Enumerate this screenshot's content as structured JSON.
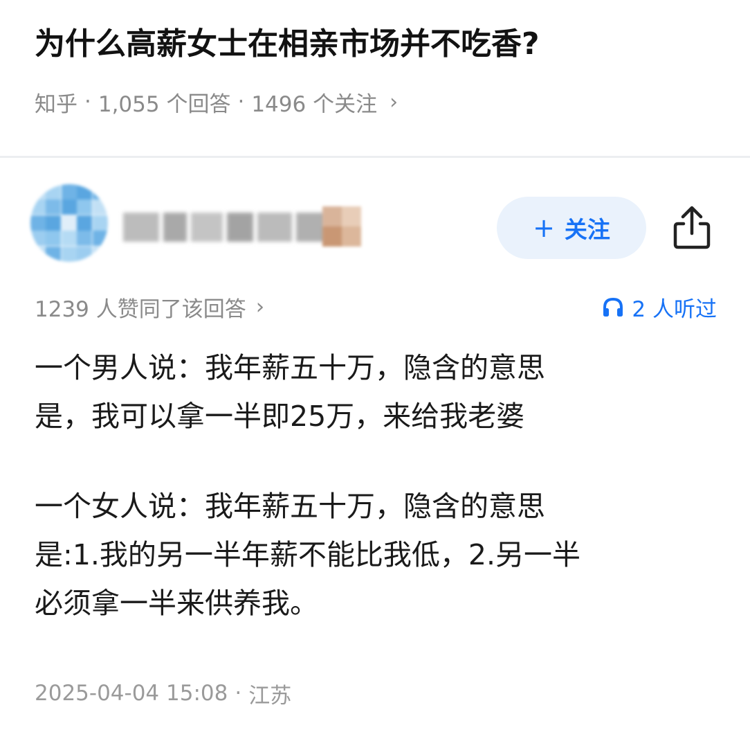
{
  "question": {
    "title": "为什么高薪女士在相亲市场并不吃香?",
    "source": "知乎",
    "separator": "·",
    "answers_count": "1,055 个回答",
    "followers_count": "1496 个关注",
    "chevron": "›"
  },
  "author": {
    "avatar_icon": "avatar-icon",
    "follow_label": "关注",
    "follow_plus": "+",
    "share_icon": "share-icon",
    "accent_color": "#1772f6"
  },
  "stats": {
    "upvotes": "1239 人赞同了该回答",
    "chevron": "›",
    "listen_icon": "headphones-icon",
    "listeners": "2 人听过"
  },
  "answer": {
    "paragraphs": [
      [
        "一个男人说：我年薪五十万，隐含的意思",
        "是，我可以拿一半即25万，来给我老婆"
      ],
      [
        "一个女人说：我年薪五十万，隐含的意思",
        "是:1.我的另一半年薪不能比我低，2.另一半",
        "必须拿一半来供养我。"
      ]
    ]
  },
  "footer": {
    "date": "2025-04-04 15:08",
    "separator": "·",
    "location": "江苏"
  }
}
